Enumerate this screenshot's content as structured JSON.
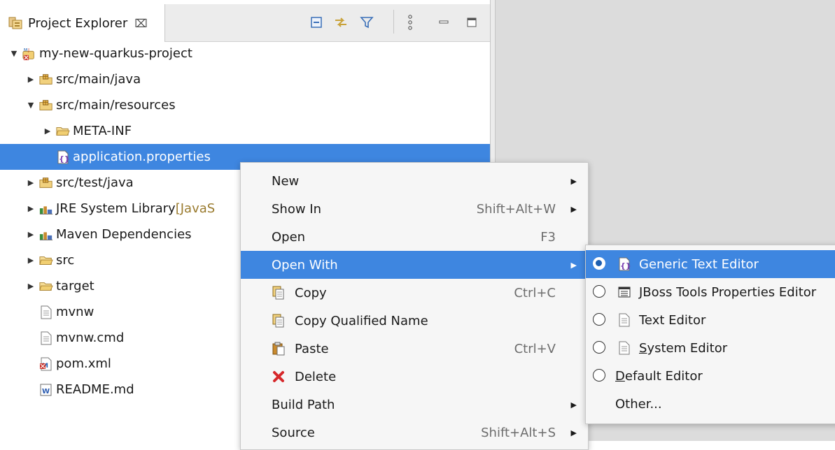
{
  "view": {
    "title": "Project Explorer",
    "close_glyph": "⌧",
    "toolbar_icons": [
      "collapse-all-icon",
      "link-with-editor-icon",
      "filter-icon",
      "view-menu-icon",
      "minimize-icon",
      "maximize-icon"
    ]
  },
  "tree": [
    {
      "label": "my-new-quarkus-project",
      "decoration": "",
      "icon": "maven-project-icon",
      "expanded": "open",
      "selected": false
    },
    {
      "label": "src/main/java",
      "decoration": "",
      "icon": "source-folder-icon",
      "expanded": "closed",
      "selected": false
    },
    {
      "label": "src/main/resources",
      "decoration": "",
      "icon": "source-folder-icon",
      "expanded": "open",
      "selected": false
    },
    {
      "label": "META-INF",
      "decoration": "",
      "icon": "folder-icon",
      "expanded": "closed",
      "selected": false
    },
    {
      "label": "application.properties",
      "decoration": "",
      "icon": "properties-file-icon",
      "expanded": "none",
      "selected": true
    },
    {
      "label": "src/test/java",
      "decoration": "",
      "icon": "source-folder-icon",
      "expanded": "closed",
      "selected": false
    },
    {
      "label": "JRE System Library ",
      "decoration": "[JavaS",
      "icon": "library-icon",
      "expanded": "closed",
      "selected": false
    },
    {
      "label": "Maven Dependencies",
      "decoration": "",
      "icon": "library-icon",
      "expanded": "closed",
      "selected": false
    },
    {
      "label": "src",
      "decoration": "",
      "icon": "folder-icon",
      "expanded": "closed",
      "selected": false
    },
    {
      "label": "target",
      "decoration": "",
      "icon": "folder-icon",
      "expanded": "closed",
      "selected": false
    },
    {
      "label": "mvnw",
      "decoration": "",
      "icon": "file-icon",
      "expanded": "none",
      "selected": false
    },
    {
      "label": "mvnw.cmd",
      "decoration": "",
      "icon": "file-icon",
      "expanded": "none",
      "selected": false
    },
    {
      "label": "pom.xml",
      "decoration": "",
      "icon": "pom-file-icon",
      "expanded": "none",
      "selected": false
    },
    {
      "label": "README.md",
      "decoration": "",
      "icon": "markdown-file-icon",
      "expanded": "none",
      "selected": false
    }
  ],
  "context_menu": [
    {
      "label": "New",
      "accelerator": "",
      "submenu": true,
      "icon": ""
    },
    {
      "label": "Show In",
      "accelerator": "Shift+Alt+W",
      "submenu": true,
      "icon": ""
    },
    {
      "label": "Open",
      "accelerator": "F3",
      "submenu": false,
      "icon": ""
    },
    {
      "label": "Open With",
      "accelerator": "",
      "submenu": true,
      "icon": "",
      "highlighted": true
    },
    {
      "label": "Copy",
      "accelerator": "Ctrl+C",
      "submenu": false,
      "icon": "copy-icon"
    },
    {
      "label": "Copy Qualified Name",
      "accelerator": "",
      "submenu": false,
      "icon": "copy-qualified-name-icon"
    },
    {
      "label": "Paste",
      "accelerator": "Ctrl+V",
      "submenu": false,
      "icon": "paste-icon"
    },
    {
      "label": "Delete",
      "accelerator": "",
      "submenu": false,
      "icon": "delete-icon"
    },
    {
      "label": "Build Path",
      "accelerator": "",
      "submenu": true,
      "icon": ""
    },
    {
      "label": "Source",
      "accelerator": "Shift+Alt+S",
      "submenu": true,
      "icon": ""
    }
  ],
  "open_with_submenu": [
    {
      "label": "Generic Text Editor",
      "checked": true,
      "icon": "generic-text-editor-icon",
      "highlighted": true
    },
    {
      "label": "JBoss Tools Properties Editor",
      "checked": false,
      "icon": "properties-editor-icon"
    },
    {
      "label": "Text Editor",
      "checked": false,
      "icon": "text-editor-icon"
    },
    {
      "label_mnemonic": "S",
      "label_rest": "ystem Editor",
      "checked": false,
      "icon": "system-editor-icon"
    },
    {
      "label_mnemonic": "D",
      "label_rest": "efault Editor",
      "checked": false,
      "icon": ""
    },
    {
      "label": "Other...",
      "icon": ""
    }
  ],
  "colors": {
    "selection": "#3e86e0",
    "editor_area": "#dcdcdc",
    "menu_bg": "#f6f6f6"
  }
}
